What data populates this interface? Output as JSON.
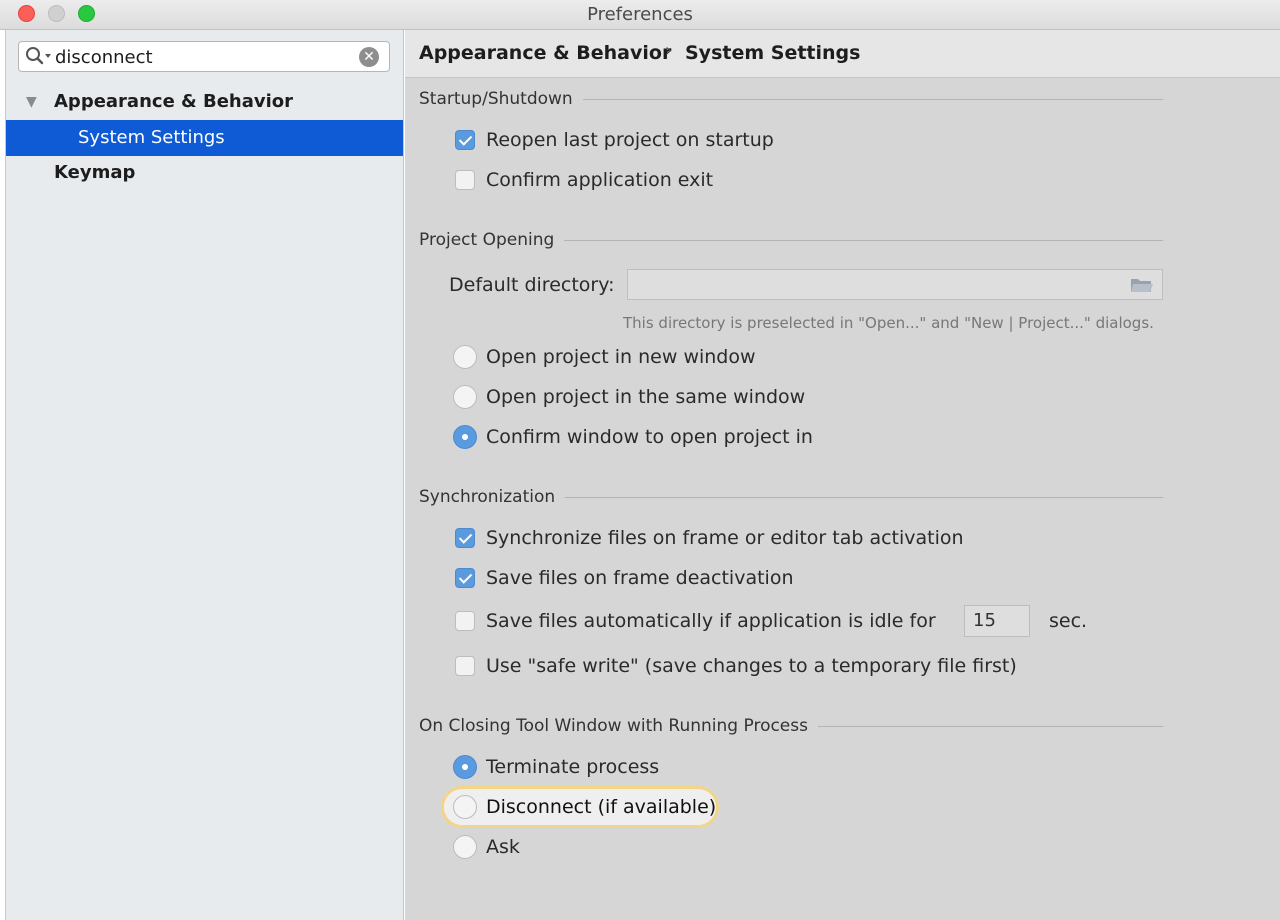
{
  "window": {
    "title": "Preferences"
  },
  "sidebar": {
    "search_value": "disconnect",
    "search_icon": "search-icon",
    "clear_icon": "clear-icon",
    "clear_glyph": "✕",
    "tree": {
      "appearance_arrow": "▼",
      "appearance_label": "Appearance & Behavior",
      "system_settings_label": "System Settings",
      "keymap_label": "Keymap"
    }
  },
  "breadcrumb": {
    "parent": "Appearance & Behavior",
    "separator": "›",
    "current": "System Settings"
  },
  "sections": {
    "startup": {
      "title": "Startup/Shutdown",
      "reopen_last_project": {
        "label": "Reopen last project on startup",
        "checked": true
      },
      "confirm_exit": {
        "label": "Confirm application exit",
        "checked": false
      }
    },
    "project_opening": {
      "title": "Project Opening",
      "default_directory_label": "Default directory:",
      "default_directory_value": "",
      "hint": "This directory is preselected in \"Open...\" and \"New | Project...\" dialogs.",
      "new_window": {
        "label": "Open project in new window",
        "selected": false
      },
      "same_window": {
        "label": "Open project in the same window",
        "selected": false
      },
      "confirm_window": {
        "label": "Confirm window to open project in",
        "selected": true
      }
    },
    "synchronization": {
      "title": "Synchronization",
      "sync_on_activation": {
        "label": "Synchronize files on frame or editor tab activation",
        "checked": true
      },
      "save_on_deactivation": {
        "label": "Save files on frame deactivation",
        "checked": true
      },
      "save_idle": {
        "label": "Save files automatically if application is idle for",
        "checked": false,
        "value": "15",
        "unit": "sec."
      },
      "safe_write": {
        "label": "Use \"safe write\" (save changes to a temporary file first)",
        "checked": false
      }
    },
    "closing_tool_window": {
      "title": "On Closing Tool Window with Running Process",
      "terminate": {
        "label": "Terminate process",
        "selected": true
      },
      "disconnect": {
        "label": "Disconnect (if available)",
        "selected": false
      },
      "ask": {
        "label": "Ask",
        "selected": false
      }
    }
  },
  "colors": {
    "selection": "#0f5bd6",
    "checked_control": "#5a9be0",
    "search_highlight": "#f3d58a"
  }
}
